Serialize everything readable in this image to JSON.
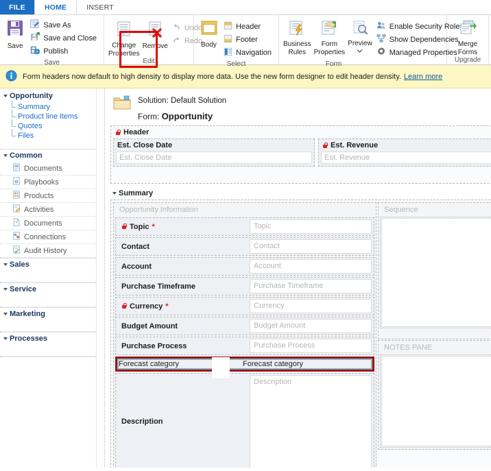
{
  "window": {
    "tabs": [
      {
        "label": "FILE",
        "id": "file",
        "style": "file"
      },
      {
        "label": "HOME",
        "id": "home",
        "style": "active"
      },
      {
        "label": "INSERT",
        "id": "insert",
        "style": "plain"
      }
    ]
  },
  "ribbon": {
    "groups": [
      {
        "name": "save",
        "title": "Save",
        "big": [
          {
            "label": "Save",
            "icon": "save-disk-icon"
          }
        ],
        "small": [
          {
            "label": "Save As",
            "icon": "save-as-icon",
            "disabled": false
          },
          {
            "label": "Save and Close",
            "icon": "save-and-close-icon",
            "disabled": false
          },
          {
            "label": "Publish",
            "icon": "publish-icon",
            "disabled": false
          }
        ]
      },
      {
        "name": "edit",
        "title": "Edit",
        "big": [
          {
            "label": "Change",
            "label2": "Properties",
            "icon": "change-properties-icon"
          },
          {
            "label": "Remove",
            "icon": "remove-icon",
            "highlighted": true
          }
        ],
        "small": [
          {
            "label": "Undo",
            "icon": "undo-icon",
            "disabled": true
          },
          {
            "label": "Redo",
            "icon": "redo-icon",
            "disabled": true
          }
        ]
      },
      {
        "name": "select",
        "title": "Select",
        "big": [
          {
            "label": "Body",
            "icon": "body-icon"
          }
        ],
        "small": [
          {
            "label": "Header",
            "icon": "header-icon",
            "disabled": false
          },
          {
            "label": "Footer",
            "icon": "footer-icon",
            "disabled": false
          },
          {
            "label": "Navigation",
            "icon": "navigation-icon",
            "disabled": false
          }
        ]
      },
      {
        "name": "form",
        "title": "Form",
        "big": [
          {
            "label": "Business",
            "label2": "Rules",
            "icon": "business-rules-icon"
          },
          {
            "label": "Form",
            "label2": "Properties",
            "icon": "form-properties-icon"
          },
          {
            "label": "Preview",
            "icon": "preview-icon",
            "dropdown": true
          }
        ],
        "small": [
          {
            "label": "Enable Security Roles",
            "icon": "enable-security-roles-icon",
            "disabled": false
          },
          {
            "label": "Show Dependencies",
            "icon": "show-dependencies-icon",
            "disabled": false
          },
          {
            "label": "Managed Properties",
            "icon": "managed-properties-icon",
            "disabled": false
          }
        ]
      },
      {
        "name": "upgrade",
        "title": "Upgrade",
        "big": [
          {
            "label": "Merge",
            "label2": "Forms",
            "icon": "merge-forms-icon"
          }
        ],
        "small": []
      }
    ]
  },
  "notification": {
    "icon": "info-icon",
    "message": "Form headers now default to high density to display more data. Use the new form designer to edit header density.",
    "link_label": "Learn more"
  },
  "sidebar": {
    "entity": {
      "label": "Opportunity",
      "links": [
        {
          "label": "Summary"
        },
        {
          "label": "Product line items"
        },
        {
          "label": "Quotes"
        },
        {
          "label": "Files"
        }
      ]
    },
    "groups": [
      {
        "label": "Common",
        "items": [
          {
            "label": "Documents",
            "icon": "documents-icon"
          },
          {
            "label": "Playbooks",
            "icon": "playbooks-icon"
          },
          {
            "label": "Products",
            "icon": "products-icon"
          },
          {
            "label": "Activities",
            "icon": "activities-icon"
          },
          {
            "label": "Documents",
            "icon": "documents-alt-icon"
          },
          {
            "label": "Connections",
            "icon": "connections-icon"
          },
          {
            "label": "Audit History",
            "icon": "audit-history-icon"
          }
        ]
      },
      {
        "label": "Sales",
        "items": []
      },
      {
        "label": "Service",
        "items": []
      },
      {
        "label": "Marketing",
        "items": []
      },
      {
        "label": "Processes",
        "items": []
      }
    ]
  },
  "canvas": {
    "folder_icon": "solution-folder-icon",
    "solution_prefix": "Solution:",
    "solution_name": "Default Solution",
    "form_prefix": "Form:",
    "form_name": "Opportunity",
    "header_section": {
      "title": "Header",
      "locked": true,
      "fields": [
        {
          "label": "Est. Close Date",
          "placeholder": "Est. Close Date",
          "locked": false
        },
        {
          "label": "Est. Revenue",
          "placeholder": "Est. Revenue",
          "locked": true
        }
      ]
    },
    "summary_section": {
      "title": "Summary",
      "left_group": {
        "title": "Opportunity Information",
        "rows": [
          {
            "label": "Topic",
            "placeholder": "Topic",
            "locked": true,
            "required": true
          },
          {
            "label": "Contact",
            "placeholder": "Contact",
            "locked": false,
            "required": false
          },
          {
            "label": "Account",
            "placeholder": "Account",
            "locked": false,
            "required": false
          },
          {
            "label": "Purchase Timeframe",
            "placeholder": "Purchase Timeframe",
            "locked": false,
            "required": false
          },
          {
            "label": "Currency",
            "placeholder": "Currency",
            "locked": true,
            "required": true
          },
          {
            "label": "Budget Amount",
            "placeholder": "Budget Amount",
            "locked": false,
            "required": false
          },
          {
            "label": "Purchase Process",
            "placeholder": "Purchase Process",
            "locked": false,
            "required": false
          },
          {
            "label": "Forecast category",
            "placeholder": "Forecast category",
            "locked": false,
            "required": false,
            "selected": true
          },
          {
            "label": "Description",
            "placeholder": "Description",
            "locked": false,
            "required": false,
            "multiline": true
          }
        ]
      },
      "right_groups": [
        {
          "title": "Sequence"
        },
        {
          "title": "NOTES PANE"
        }
      ]
    }
  },
  "colors": {
    "accent": "#1b6ec2",
    "file_tab": "#1b6ec2",
    "notification_bg": "#fdf7c3",
    "highlight_red": "#9c1616",
    "remove_highlight_red": "#e00000",
    "required_red": "#e02020",
    "selection_blue": "#8db4c6",
    "row_bg": "#edf0f4"
  }
}
